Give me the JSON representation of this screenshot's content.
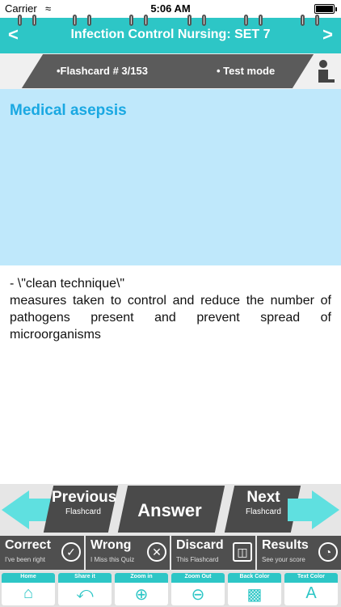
{
  "status": {
    "carrier": "Carrier",
    "time": "5:06 AM"
  },
  "header": {
    "title": "Infection Control Nursing: SET 7",
    "back": "<",
    "forward": ">"
  },
  "subheader": {
    "flashcard": "•Flashcard #  3/153",
    "mode": "• Test mode"
  },
  "question": {
    "text": "Medical asepsis"
  },
  "answer": {
    "line1": "- \\\"clean technique\\\"",
    "line2": "measures taken to control and reduce the number of pathogens present and prevent spread of microorganisms"
  },
  "controls": {
    "previous": {
      "label": "Previous",
      "sub": "Flashcard"
    },
    "answer": {
      "label": "Answer"
    },
    "next": {
      "label": "Next",
      "sub": "Flashcard"
    }
  },
  "actions": [
    {
      "label": "Correct",
      "sub": "I've been right",
      "icon": "check-icon"
    },
    {
      "label": "Wrong",
      "sub": "I Miss this Quiz",
      "icon": "close-icon"
    },
    {
      "label": "Discard",
      "sub": "This Flashcard",
      "icon": "trash-icon"
    },
    {
      "label": "Results",
      "sub": "See your score",
      "icon": "pie-chart-icon"
    }
  ],
  "toolbar": [
    {
      "label": "Home",
      "icon": "home-icon"
    },
    {
      "label": "Share it",
      "icon": "share-icon"
    },
    {
      "label": "Zoom in",
      "icon": "zoom-in-icon"
    },
    {
      "label": "Zoom Out",
      "icon": "zoom-out-icon"
    },
    {
      "label": "Back Color",
      "icon": "paint-bucket-icon"
    },
    {
      "label": "Text Color",
      "icon": "text-color-icon"
    }
  ],
  "colors": {
    "accent": "#2dc6c6",
    "question_bg": "#bfe8fb",
    "question_text": "#1aa8e2",
    "dark_button": "#4a4a4a"
  }
}
